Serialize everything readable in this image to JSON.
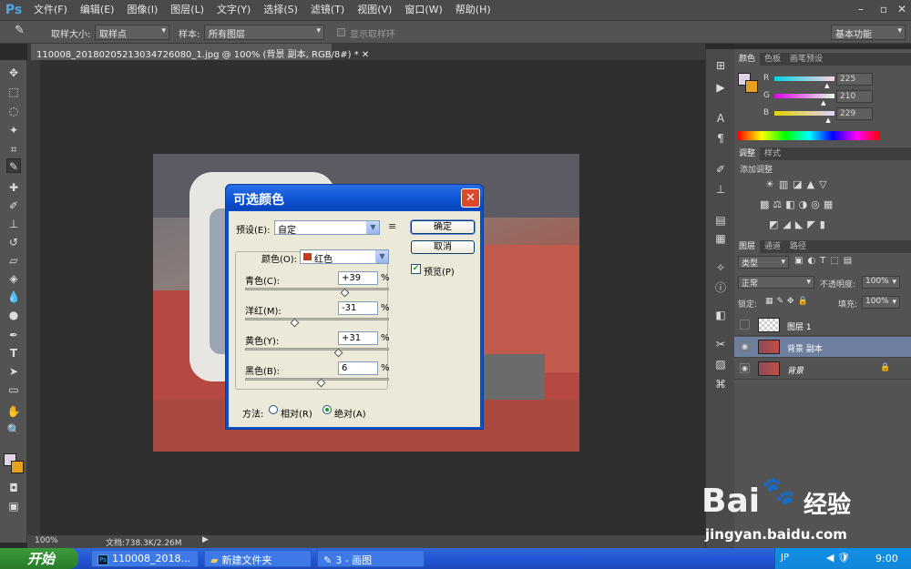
{
  "app": {
    "logo": "Ps"
  },
  "menu": [
    "文件(F)",
    "编辑(E)",
    "图像(I)",
    "图层(L)",
    "文字(Y)",
    "选择(S)",
    "滤镜(T)",
    "视图(V)",
    "窗口(W)",
    "帮助(H)"
  ],
  "window_controls": {
    "minimize": "–",
    "restore": "▫",
    "close": "✕"
  },
  "options": {
    "sample_size_label": "取样大小:",
    "sample_size_value": "取样点",
    "sample_label": "样本:",
    "sample_value": "所有图层",
    "show_ring_label": "显示取样环",
    "workspace": "基本功能"
  },
  "document_tab": "110008_20180205213034726080_1.jpg @ 100% (背景 副本, RGB/8#) * ✕",
  "status": {
    "zoom": "100%",
    "doc": "文档:738.3K/2.26M"
  },
  "panels": {
    "color_tabs": [
      "颜色",
      "色板",
      "画笔预设"
    ],
    "color": {
      "r_label": "R",
      "g_label": "G",
      "b_label": "B",
      "r": "225",
      "g": "210",
      "b": "229",
      "r_frac": 0.88,
      "g_frac": 0.82,
      "b_frac": 0.9
    },
    "adjust_tabs": [
      "调整",
      "样式"
    ],
    "adjust_title": "添加调整",
    "layer_tabs": [
      "图层",
      "通道",
      "路径"
    ],
    "layer_filter": "类型",
    "blend_mode": "正常",
    "opacity_label": "不透明度:",
    "opacity": "100%",
    "lock_label": "锁定:",
    "fill_label": "填充:",
    "fill": "100%",
    "layers": [
      {
        "name": "图层 1",
        "visible": false,
        "selected": false,
        "locked": false
      },
      {
        "name": "背景 副本",
        "visible": true,
        "selected": true,
        "locked": false
      },
      {
        "name": "背景",
        "visible": true,
        "selected": false,
        "locked": true
      }
    ]
  },
  "dialog": {
    "title": "可选颜色",
    "close": "✕",
    "preset_label": "预设(E):",
    "preset_value": "自定",
    "ok": "确定",
    "cancel": "取消",
    "preview_label": "预览(P)",
    "preview_checked": true,
    "colors_label": "颜色(O):",
    "colors_value": "红色",
    "swatch_color": "#c83a1a",
    "sliders": [
      {
        "label": "青色(C):",
        "value": "+39",
        "pct": 39
      },
      {
        "label": "洋红(M):",
        "value": "-31",
        "pct": -31
      },
      {
        "label": "黄色(Y):",
        "value": "+31",
        "pct": 31
      },
      {
        "label": "黑色(B):",
        "value": "6",
        "pct": 6
      }
    ],
    "percent": "%",
    "method_label": "方法:",
    "relative_label": "相对(R)",
    "absolute_label": "绝对(A)",
    "method_selected": "absolute"
  },
  "taskbar": {
    "start": "开始",
    "items": [
      "110008_2018...",
      "新建文件夹",
      "3 - 画图"
    ],
    "tray_lang": "JP",
    "time": "9:00"
  },
  "watermark": {
    "brand": "Bai",
    "brand2": "经验",
    "url": "jingyan.baidu.com"
  }
}
